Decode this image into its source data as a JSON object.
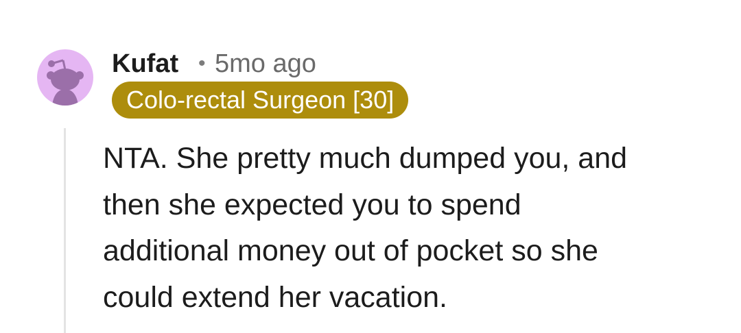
{
  "comment": {
    "author": "Kufat",
    "separator": "•",
    "timestamp": "5mo ago",
    "flair": "Colo-rectal Surgeon [30]",
    "avatar_icon": "snoo-avatar-icon",
    "body_lines": [
      "NTA. She pretty much dumped you, and",
      "then she expected you to spend",
      "additional money out of pocket so she",
      "could extend her vacation."
    ]
  },
  "colors": {
    "flair_background": "#ad8d0c",
    "avatar_background": "#e5b6f3",
    "thread_line": "#e3e3e3"
  }
}
